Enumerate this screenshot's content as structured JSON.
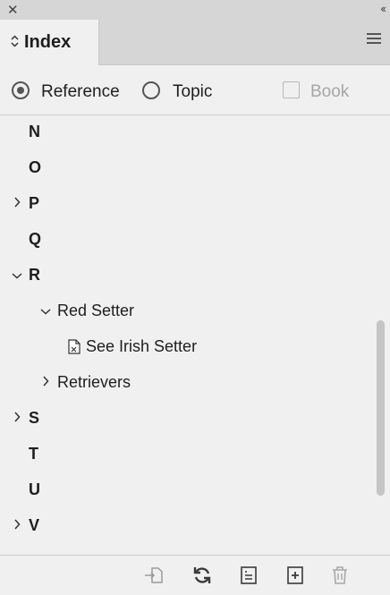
{
  "title_bar": {
    "close_glyph": "✕",
    "collapse_glyph": "‹‹"
  },
  "tab": {
    "label": "Index",
    "icon": "chevron-up-down-icon"
  },
  "options": {
    "reference_label": "Reference",
    "topic_label": "Topic",
    "book_label": "Book",
    "selected": "Reference",
    "book_checked": false
  },
  "entries": [
    {
      "label": "N"
    },
    {
      "label": "O"
    },
    {
      "label": "P",
      "expandable": true,
      "expanded": false
    },
    {
      "label": "Q"
    },
    {
      "label": "R",
      "expandable": true,
      "expanded": true
    },
    {
      "label": "Red Setter",
      "expandable": true,
      "expanded": true
    },
    {
      "label": "See Irish Setter",
      "icon": "cross-reference-page-icon"
    },
    {
      "label": "Retrievers",
      "expandable": true,
      "expanded": false
    },
    {
      "label": "S",
      "expandable": true,
      "expanded": false
    },
    {
      "label": "T"
    },
    {
      "label": "U"
    },
    {
      "label": "V",
      "expandable": true,
      "expanded": false
    }
  ],
  "footer": {
    "buttons": [
      "go-to-selected-marker-icon",
      "update-preview-icon",
      "generate-index-icon",
      "create-new-index-entry-icon",
      "delete-entry-icon"
    ]
  },
  "colors": {
    "panel": "#f0f0f0",
    "header": "#d6d6d6",
    "text": "#1e1e1e",
    "disabled": "#a6a6a6"
  }
}
